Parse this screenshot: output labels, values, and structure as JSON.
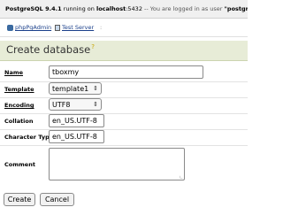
{
  "topbar": {
    "server_version": "PostgreSQL 9.4.1",
    "running_on": " running on ",
    "host": "localhost",
    "port": ":5432",
    "logged_in": " -- You are logged in as user ",
    "user": "\"postgres\""
  },
  "breadcrumb": {
    "app": "phpPgAdmin",
    "separator": ":",
    "server": "Test Server",
    "trail_end": ":"
  },
  "heading": {
    "title": "Create database",
    "help": "?"
  },
  "form": {
    "name": {
      "label": "Name",
      "value": "tboxmy"
    },
    "template": {
      "label": "Template",
      "value": "template1"
    },
    "encoding": {
      "label": "Encoding",
      "value": "UTF8"
    },
    "collation": {
      "label": "Collation",
      "value": "en_US.UTF-8"
    },
    "character_type": {
      "label": "Character Type",
      "value": "en_US.UTF-8"
    },
    "comment": {
      "label": "Comment",
      "value": ""
    }
  },
  "buttons": {
    "create": "Create",
    "cancel": "Cancel"
  }
}
